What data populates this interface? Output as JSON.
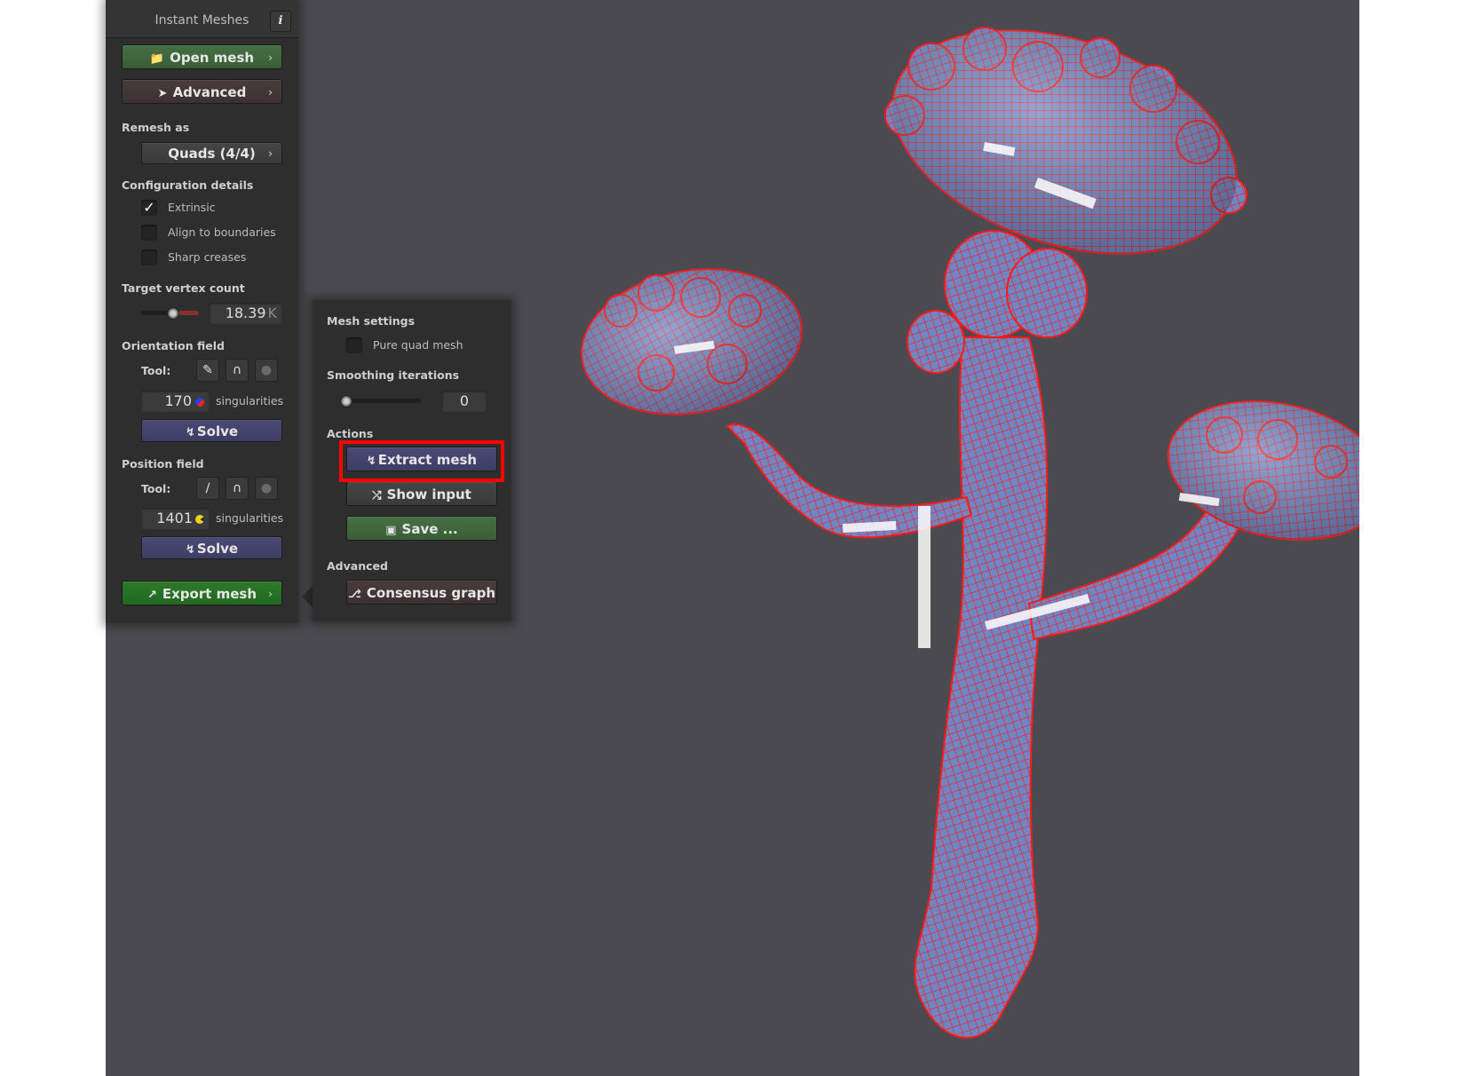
{
  "app": {
    "title": "Instant Meshes",
    "info_label": "i"
  },
  "main_panel": {
    "open_mesh": {
      "label": "Open mesh",
      "icon": "folder-icon",
      "chevron": "›"
    },
    "advanced": {
      "label": "Advanced",
      "icon": "rocket-icon",
      "chevron": "›"
    },
    "remesh_as": {
      "label": "Remesh as",
      "value": "Quads (4/4)",
      "chevron": "›"
    },
    "configuration": {
      "label": "Configuration details",
      "options": [
        {
          "label": "Extrinsic",
          "checked": true
        },
        {
          "label": "Align to boundaries",
          "checked": false
        },
        {
          "label": "Sharp creases",
          "checked": false
        }
      ]
    },
    "target_vertex_count": {
      "label": "Target vertex count",
      "value": "18.39",
      "unit": "K",
      "slider_fraction": 0.55
    },
    "orientation_field": {
      "label": "Orientation field",
      "tool_label": "Tool:",
      "tools": [
        "comb-icon",
        "magnet-icon",
        "ghost-icon"
      ],
      "singularities_value": "170",
      "singularities_label": "singularities",
      "solve_label": "Solve"
    },
    "position_field": {
      "label": "Position field",
      "tool_label": "Tool:",
      "tools": [
        "brush-icon",
        "magnet-icon",
        "ghost-icon"
      ],
      "singularities_value": "1401",
      "singularities_label": "singularities",
      "solve_label": "Solve"
    },
    "export_mesh": {
      "label": "Export mesh",
      "icon": "export-icon",
      "chevron": "›"
    }
  },
  "popup_panel": {
    "mesh_settings": {
      "label": "Mesh settings",
      "pure_quad": {
        "label": "Pure quad mesh",
        "checked": false
      }
    },
    "smoothing": {
      "label": "Smoothing iterations",
      "value": "0",
      "slider_fraction": 0.0
    },
    "actions": {
      "label": "Actions",
      "extract_mesh": "Extract mesh",
      "show_input": "Show input",
      "save": "Save ..."
    },
    "advanced": {
      "label": "Advanced",
      "consensus_graph": "Consensus graph"
    }
  },
  "colors": {
    "viewport_bg": "#4a4a50",
    "mesh_fill": "#6e86c4",
    "mesh_wire": "#ff1a1a",
    "highlight": "#ff0000"
  }
}
